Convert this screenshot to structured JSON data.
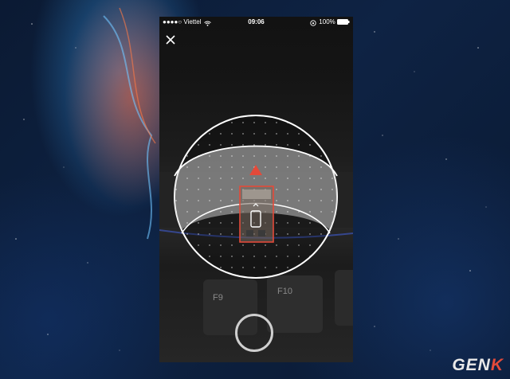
{
  "status_bar": {
    "carrier": "●●●●○ Viettel",
    "time": "09:06",
    "battery": "100%"
  },
  "icons": {
    "close": "close-icon",
    "wifi": "wifi-icon",
    "battery": "battery-icon",
    "rotation_lock": "rotation-lock-icon",
    "target_arrow": "up-arrow-icon",
    "device": "phone-icon",
    "chevron": "chevron-up-icon"
  },
  "colors": {
    "accent_red": "#e34a3a",
    "guide_white": "#ffffff"
  },
  "watermark": {
    "text_main": "GEN",
    "text_accent": "K"
  }
}
